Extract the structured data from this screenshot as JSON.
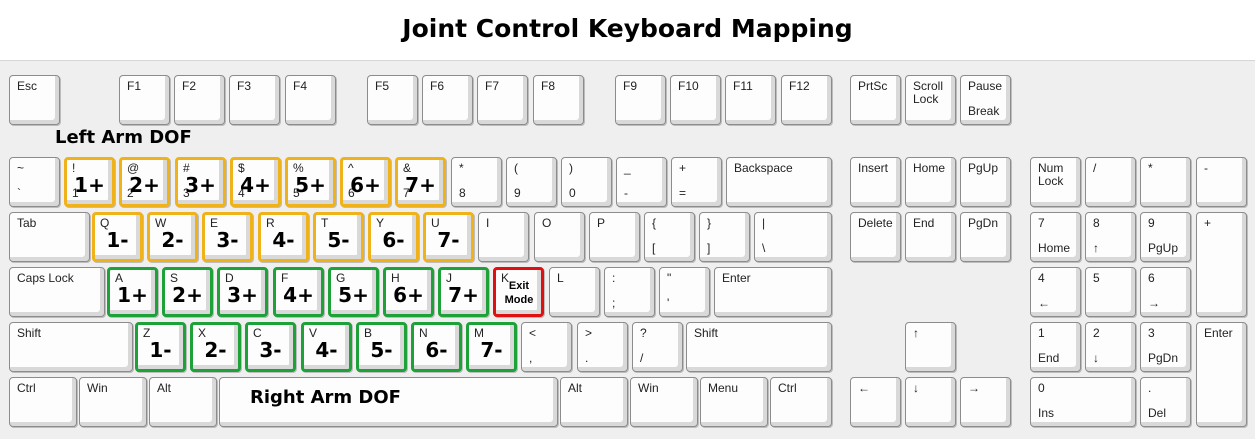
{
  "title": "Joint Control Keyboard Mapping",
  "labels": {
    "left_arm": "Left Arm DOF",
    "right_arm": "Right Arm DOF"
  },
  "colors": {
    "left_arm_outline": "#f0b21b",
    "right_arm_outline": "#1fa13a",
    "exit_outline": "#e01010"
  },
  "keys": [
    {
      "id": "esc",
      "top": "Esc"
    },
    {
      "id": "f1",
      "top": "F1"
    },
    {
      "id": "f2",
      "top": "F2"
    },
    {
      "id": "f3",
      "top": "F3"
    },
    {
      "id": "f4",
      "top": "F4"
    },
    {
      "id": "f5",
      "top": "F5"
    },
    {
      "id": "f6",
      "top": "F6"
    },
    {
      "id": "f7",
      "top": "F7"
    },
    {
      "id": "f8",
      "top": "F8"
    },
    {
      "id": "f9",
      "top": "F9"
    },
    {
      "id": "f10",
      "top": "F10"
    },
    {
      "id": "f11",
      "top": "F11"
    },
    {
      "id": "f12",
      "top": "F12"
    },
    {
      "id": "prtsc",
      "top": "PrtSc"
    },
    {
      "id": "scrolllock",
      "top": "Scroll\nLock"
    },
    {
      "id": "pause",
      "top": "Pause",
      "bottom": "Break"
    },
    {
      "id": "backtick",
      "top": "~",
      "bottom": "`"
    },
    {
      "id": "d1",
      "top": "!",
      "bottom": "1",
      "mapping": "1+",
      "group": "left"
    },
    {
      "id": "d2",
      "top": "@",
      "bottom": "2",
      "mapping": "2+",
      "group": "left"
    },
    {
      "id": "d3",
      "top": "#",
      "bottom": "3",
      "mapping": "3+",
      "group": "left"
    },
    {
      "id": "d4",
      "top": "$",
      "bottom": "4",
      "mapping": "4+",
      "group": "left"
    },
    {
      "id": "d5",
      "top": "%",
      "bottom": "5",
      "mapping": "5+",
      "group": "left"
    },
    {
      "id": "d6",
      "top": "^",
      "bottom": "6",
      "mapping": "6+",
      "group": "left"
    },
    {
      "id": "d7",
      "top": "&",
      "bottom": "7",
      "mapping": "7+",
      "group": "left"
    },
    {
      "id": "d8",
      "top": "*",
      "bottom": "8"
    },
    {
      "id": "d9",
      "top": "(",
      "bottom": "9"
    },
    {
      "id": "d0",
      "top": ")",
      "bottom": "0"
    },
    {
      "id": "minus",
      "top": "_",
      "bottom": "-"
    },
    {
      "id": "equals",
      "top": "+",
      "bottom": "="
    },
    {
      "id": "backspace",
      "top": "Backspace"
    },
    {
      "id": "insert",
      "top": "Insert"
    },
    {
      "id": "home",
      "top": "Home"
    },
    {
      "id": "pgup",
      "top": "PgUp"
    },
    {
      "id": "numlock",
      "top": "Num\nLock"
    },
    {
      "id": "numslash",
      "top": "/"
    },
    {
      "id": "numstar",
      "top": "*"
    },
    {
      "id": "numminus",
      "top": "-"
    },
    {
      "id": "tab",
      "top": "Tab"
    },
    {
      "id": "q",
      "top": "Q",
      "mapping": "1-",
      "group": "left"
    },
    {
      "id": "w",
      "top": "W",
      "mapping": "2-",
      "group": "left"
    },
    {
      "id": "e",
      "top": "E",
      "mapping": "3-",
      "group": "left"
    },
    {
      "id": "r",
      "top": "R",
      "mapping": "4-",
      "group": "left"
    },
    {
      "id": "t",
      "top": "T",
      "mapping": "5-",
      "group": "left"
    },
    {
      "id": "y",
      "top": "Y",
      "mapping": "6-",
      "group": "left"
    },
    {
      "id": "u",
      "top": "U",
      "mapping": "7-",
      "group": "left"
    },
    {
      "id": "i",
      "top": "I"
    },
    {
      "id": "o",
      "top": "O"
    },
    {
      "id": "p",
      "top": "P"
    },
    {
      "id": "lbracket",
      "top": "{",
      "bottom": "["
    },
    {
      "id": "rbracket",
      "top": "}",
      "bottom": "]"
    },
    {
      "id": "backslash",
      "top": "|",
      "bottom": "\\"
    },
    {
      "id": "delete",
      "top": "Delete"
    },
    {
      "id": "end",
      "top": "End"
    },
    {
      "id": "pgdn",
      "top": "PgDn"
    },
    {
      "id": "num7",
      "top": "7",
      "bottom": "Home"
    },
    {
      "id": "num8",
      "top": "8",
      "bottom": "↑"
    },
    {
      "id": "num9",
      "top": "9",
      "bottom": "PgUp"
    },
    {
      "id": "numplus",
      "top": "+"
    },
    {
      "id": "capslock",
      "top": "Caps Lock"
    },
    {
      "id": "a",
      "top": "A",
      "mapping": "1+",
      "group": "right"
    },
    {
      "id": "s",
      "top": "S",
      "mapping": "2+",
      "group": "right"
    },
    {
      "id": "d",
      "top": "D",
      "mapping": "3+",
      "group": "right"
    },
    {
      "id": "f",
      "top": "F",
      "mapping": "4+",
      "group": "right"
    },
    {
      "id": "g",
      "top": "G",
      "mapping": "5+",
      "group": "right"
    },
    {
      "id": "h",
      "top": "H",
      "mapping": "6+",
      "group": "right"
    },
    {
      "id": "j",
      "top": "J",
      "mapping": "7+",
      "group": "right"
    },
    {
      "id": "k",
      "top": "K",
      "mapping": "Exit\nMode",
      "group": "exit"
    },
    {
      "id": "l",
      "top": "L"
    },
    {
      "id": "semicolon",
      "top": ":",
      "bottom": ";"
    },
    {
      "id": "quote",
      "top": "\"",
      "bottom": "'"
    },
    {
      "id": "enter",
      "top": "Enter"
    },
    {
      "id": "num4",
      "top": "4",
      "bottom": "←"
    },
    {
      "id": "num5",
      "top": "5"
    },
    {
      "id": "num6",
      "top": "6",
      "bottom": "→"
    },
    {
      "id": "lshift",
      "top": "Shift"
    },
    {
      "id": "z",
      "top": "Z",
      "mapping": "1-",
      "group": "right"
    },
    {
      "id": "x",
      "top": "X",
      "mapping": "2-",
      "group": "right"
    },
    {
      "id": "c",
      "top": "C",
      "mapping": "3-",
      "group": "right"
    },
    {
      "id": "v",
      "top": "V",
      "mapping": "4-",
      "group": "right"
    },
    {
      "id": "b",
      "top": "B",
      "mapping": "5-",
      "group": "right"
    },
    {
      "id": "n",
      "top": "N",
      "mapping": "6-",
      "group": "right"
    },
    {
      "id": "m",
      "top": "M",
      "mapping": "7-",
      "group": "right"
    },
    {
      "id": "comma",
      "top": "<",
      "bottom": ","
    },
    {
      "id": "period",
      "top": ">",
      "bottom": "."
    },
    {
      "id": "slash",
      "top": "?",
      "bottom": "/"
    },
    {
      "id": "rshift",
      "top": "Shift"
    },
    {
      "id": "up",
      "top": "↑"
    },
    {
      "id": "num1",
      "top": "1",
      "bottom": "End"
    },
    {
      "id": "num2",
      "top": "2",
      "bottom": "↓"
    },
    {
      "id": "num3",
      "top": "3",
      "bottom": "PgDn"
    },
    {
      "id": "numenter",
      "top": "Enter"
    },
    {
      "id": "lctrl",
      "top": "Ctrl"
    },
    {
      "id": "lwin",
      "top": "Win"
    },
    {
      "id": "lalt",
      "top": "Alt"
    },
    {
      "id": "space"
    },
    {
      "id": "ralt",
      "top": "Alt"
    },
    {
      "id": "rwin",
      "top": "Win"
    },
    {
      "id": "menu",
      "top": "Menu"
    },
    {
      "id": "rctrl",
      "top": "Ctrl"
    },
    {
      "id": "left",
      "top": "←"
    },
    {
      "id": "down",
      "top": "↓"
    },
    {
      "id": "right",
      "top": "→"
    },
    {
      "id": "num0",
      "top": "0",
      "bottom": "Ins"
    },
    {
      "id": "numdot",
      "top": ".",
      "bottom": "Del"
    }
  ]
}
